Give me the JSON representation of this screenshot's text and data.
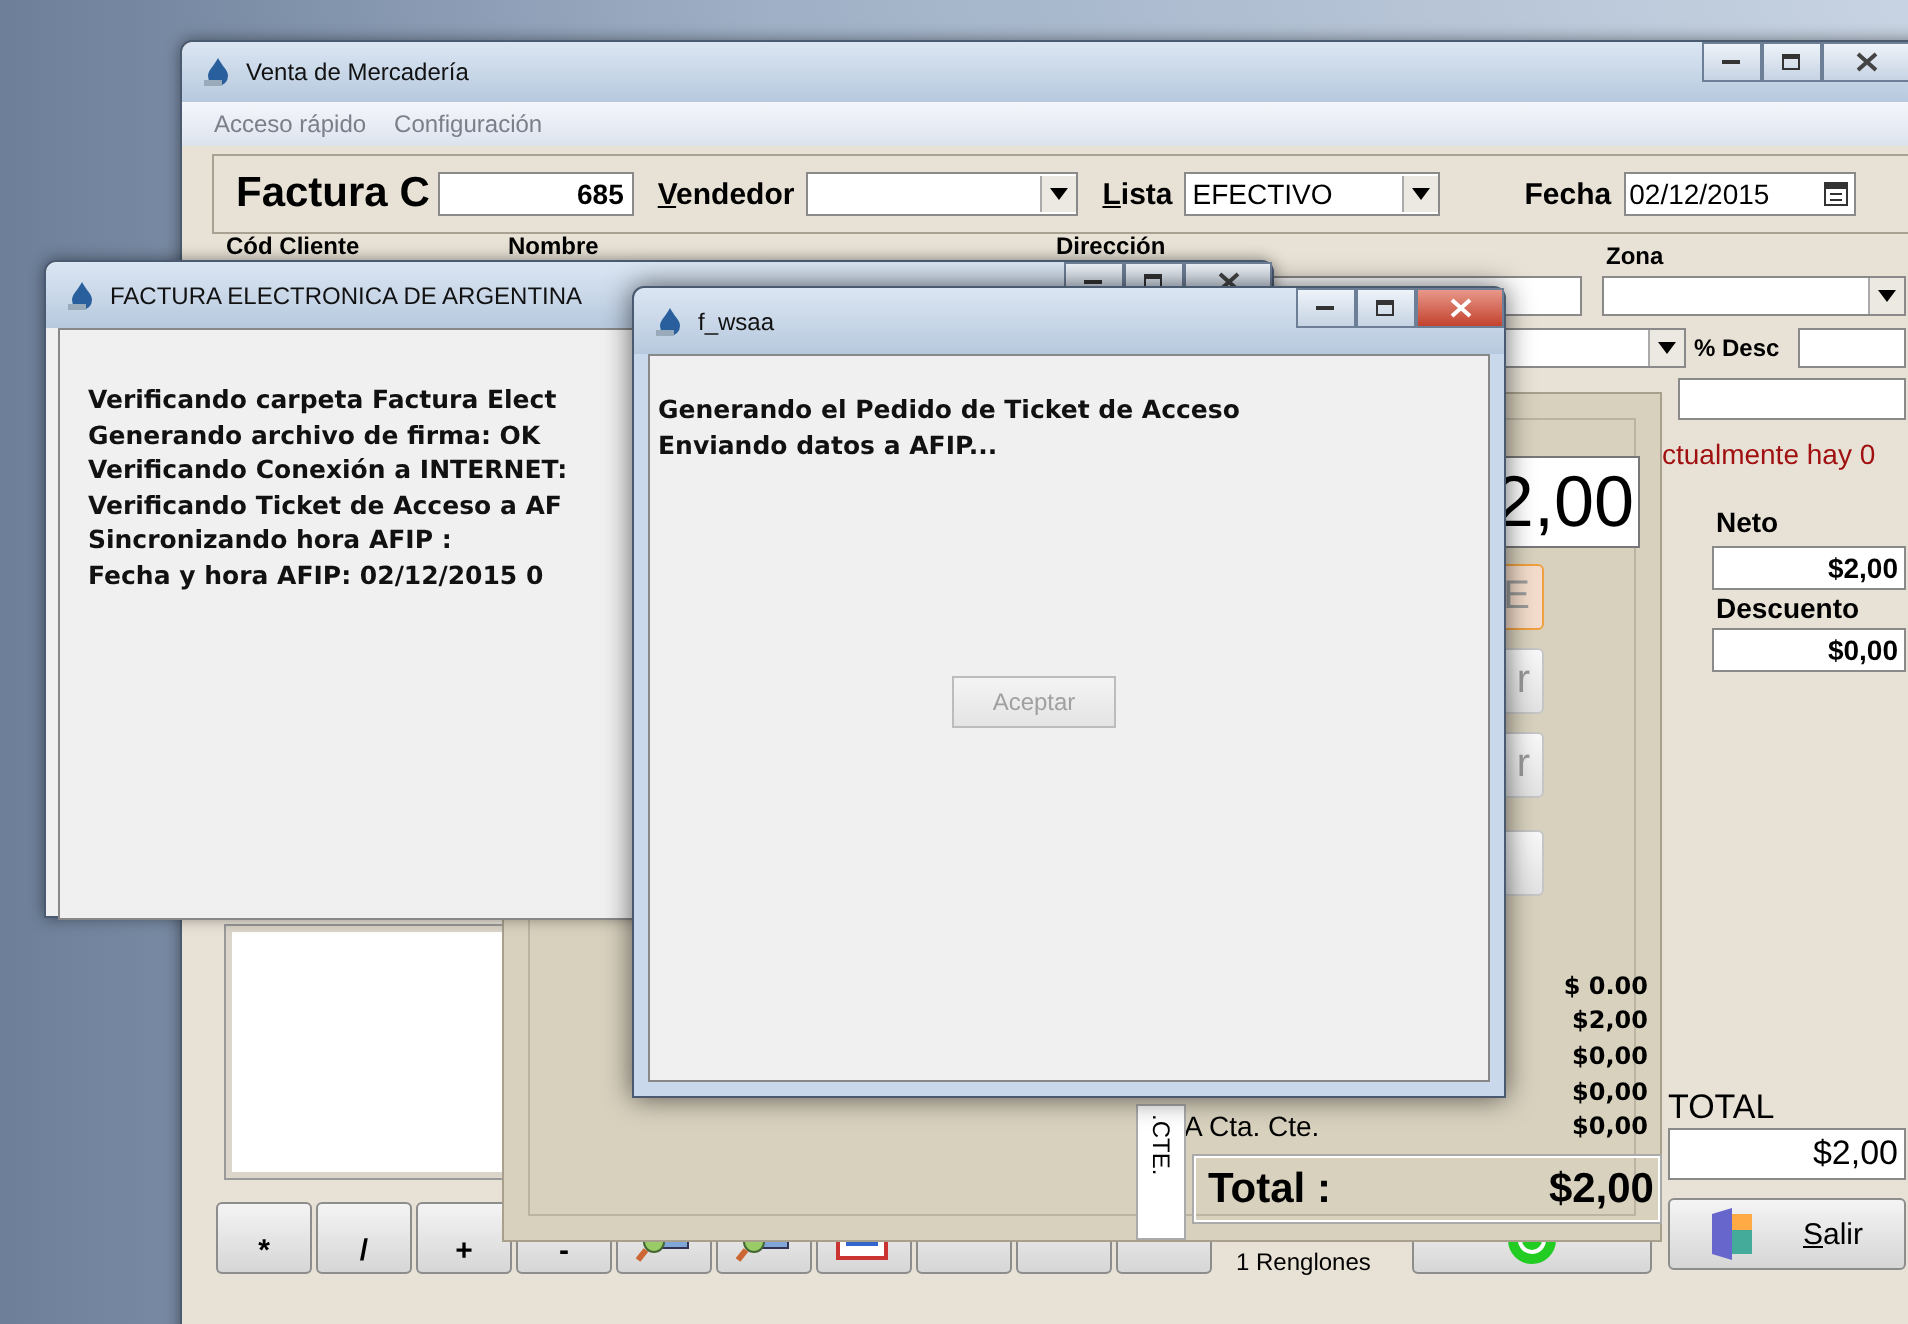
{
  "main_window": {
    "title": "Venta de Mercadería",
    "menu": [
      "Acceso rápido",
      "Configuración"
    ],
    "header": {
      "doc_type": "Factura C",
      "number": "685",
      "vendedor_label": "Vendedor",
      "lista_label": "Lista",
      "lista": "EFECTIVO",
      "fecha_label": "Fecha",
      "fecha": "02/12/2015"
    },
    "client_labels": [
      "Cód Cliente",
      "Nombre",
      "Dirección",
      "Zona"
    ],
    "desc_label": "% Desc",
    "notice": "ctualmente hay 0",
    "big_total": "2,00",
    "side_buttons": [
      {
        "label": "E",
        "selected": true
      },
      {
        "label": "r",
        "selected": false
      },
      {
        "label": "r",
        "selected": false
      }
    ],
    "neto_label": "Neto",
    "neto": "$2,00",
    "descuento_label": "Descuento",
    "descuento": "$0,00",
    "payment_rows": [
      {
        "amount": "$ 0.00"
      },
      {
        "amount": "$2,00"
      },
      {
        "amount": "$0,00"
      },
      {
        "amount": "$0,00"
      },
      {
        "label": "A Cta. Cte.",
        "amount": "$0,00"
      }
    ],
    "tab_label": ".CTE.",
    "total_label": "Total :",
    "total": "$2,00",
    "grand_total_label": "TOTAL",
    "grand_total": "$2,00",
    "keypad": [
      {
        "kind": "text",
        "label": "*"
      },
      {
        "kind": "text",
        "label": "/"
      },
      {
        "kind": "text",
        "label": "+"
      },
      {
        "kind": "text",
        "label": "-"
      },
      {
        "kind": "find"
      },
      {
        "kind": "find"
      },
      {
        "kind": "list"
      },
      {
        "kind": "blank"
      },
      {
        "kind": "blank"
      },
      {
        "kind": "blank"
      }
    ],
    "rows_count": "1 Renglones",
    "exit_button": "Salir"
  },
  "dialog_factura": {
    "title": "FACTURA ELECTRONICA DE ARGENTINA",
    "lines": [
      "Verificando carpeta Factura Elect",
      "Generando archivo de firma: OK",
      "Verificando Conexión a INTERNET:",
      "Verificando Ticket de Acceso a AF",
      "Sincronizando hora AFIP :",
      "Fecha y hora AFIP: 02/12/2015 0"
    ]
  },
  "dialog_wsaa": {
    "title": "f_wsaa",
    "lines": [
      "Generando el Pedido de Ticket de Acceso",
      "Enviando datos a AFIP..."
    ],
    "button": {
      "label": "Aceptar",
      "disabled": true
    }
  }
}
